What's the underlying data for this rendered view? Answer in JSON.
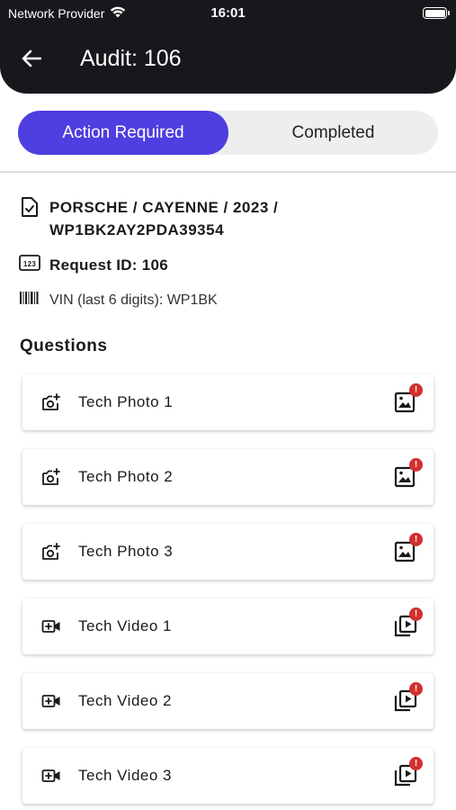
{
  "status_bar": {
    "carrier": "Network Provider",
    "time": "16:01"
  },
  "header": {
    "title": "Audit: 106"
  },
  "tabs": [
    {
      "label": "Action Required",
      "active": true
    },
    {
      "label": "Completed",
      "active": false
    }
  ],
  "vehicle": {
    "line1": "PORSCHE / CAYENNE / 2023 /",
    "line2": "WP1BK2AY2PDA39354"
  },
  "request": {
    "label": "Request ID: 106"
  },
  "vin": {
    "label": "VIN (last 6 digits): WP1BK"
  },
  "questions_section": {
    "title": "Questions"
  },
  "questions": [
    {
      "label": "Tech Photo 1",
      "type": "photo",
      "badge": "!"
    },
    {
      "label": "Tech Photo 2",
      "type": "photo",
      "badge": "!"
    },
    {
      "label": "Tech Photo 3",
      "type": "photo",
      "badge": "!"
    },
    {
      "label": "Tech Video 1",
      "type": "video",
      "badge": "!"
    },
    {
      "label": "Tech Video 2",
      "type": "video",
      "badge": "!"
    },
    {
      "label": "Tech Video 3",
      "type": "video",
      "badge": "!"
    }
  ],
  "colors": {
    "header_bg": "#17181c",
    "accent": "#4f3ee0",
    "badge": "#d32f2f"
  },
  "icons": {
    "back": "arrow-left-icon",
    "vehicle": "document-check-icon",
    "request": "numbers-123-icon",
    "vin": "barcode-icon",
    "photo": "add-photo-icon",
    "video": "add-video-icon",
    "photo_status": "image-icon",
    "video_status": "video-library-icon"
  }
}
